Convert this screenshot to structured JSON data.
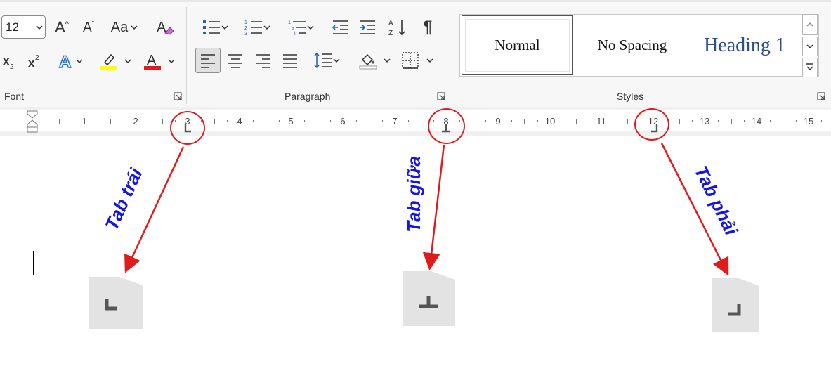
{
  "font": {
    "size_value": "12",
    "group_label": "Font"
  },
  "paragraph": {
    "group_label": "Paragraph"
  },
  "styles": {
    "group_label": "Styles",
    "items": [
      "Normal",
      "No Spacing",
      "Heading 1"
    ],
    "selected": "Normal",
    "heading_color": "#2f4e8f"
  },
  "ruler": {
    "numbers": [
      "1",
      "2",
      "3",
      "4",
      "5",
      "6",
      "7",
      "8",
      "9",
      "10",
      "11",
      "12",
      "13",
      "14",
      "15"
    ]
  },
  "annotations": {
    "left_tab_label": "Tab trái",
    "center_tab_label": "Tab giữa",
    "right_tab_label": "Tab phải",
    "label_color": "#1414e6",
    "arrow_color": "#e01b1b"
  }
}
